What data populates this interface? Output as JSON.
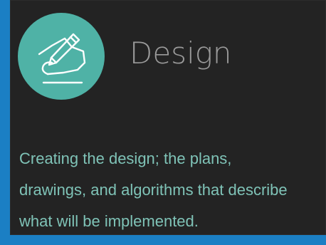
{
  "card": {
    "title": "Design",
    "icon": "pen-drawing-icon",
    "description_lines": [
      "Creating the design; the plans,",
      "drawings, and algorithms that describe",
      "what will be implemented."
    ]
  },
  "colors": {
    "background_accent": "#1b7fc4",
    "card_background": "#232323",
    "icon_circle": "#4fb2a6",
    "title_text": "#9a9a9a",
    "description_text": "#7fc3b7"
  }
}
